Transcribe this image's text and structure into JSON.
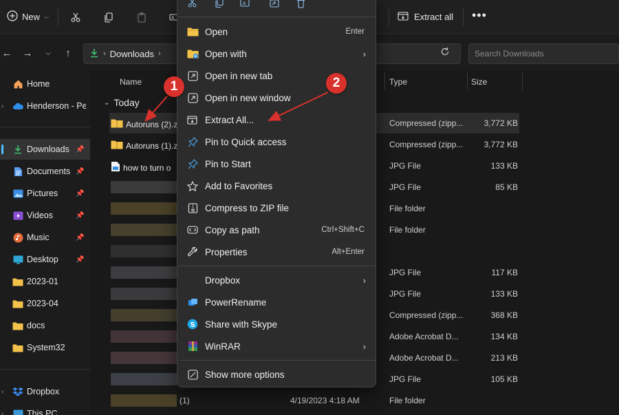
{
  "toolbar": {
    "new_label": "New",
    "extract_all_label": "Extract all",
    "more_label": "•••"
  },
  "address": {
    "path_segment": "Downloads",
    "search_placeholder": "Search Downloads"
  },
  "sidebar": {
    "items": [
      {
        "label": "Home",
        "icon": "home-icon",
        "pinned": false
      },
      {
        "label": "Henderson - Per",
        "icon": "onedrive-icon",
        "pinned": false
      },
      {
        "label": "Downloads",
        "icon": "download-icon",
        "pinned": true
      },
      {
        "label": "Documents",
        "icon": "document-icon",
        "pinned": true
      },
      {
        "label": "Pictures",
        "icon": "picture-icon",
        "pinned": true
      },
      {
        "label": "Videos",
        "icon": "video-icon",
        "pinned": true
      },
      {
        "label": "Music",
        "icon": "music-icon",
        "pinned": true
      },
      {
        "label": "Desktop",
        "icon": "desktop-icon",
        "pinned": true
      },
      {
        "label": "2023-01",
        "icon": "folder-icon",
        "pinned": false
      },
      {
        "label": "2023-04",
        "icon": "folder-icon",
        "pinned": false
      },
      {
        "label": "docs",
        "icon": "folder-icon",
        "pinned": false
      },
      {
        "label": "System32",
        "icon": "folder-icon",
        "pinned": false
      },
      {
        "label": "Dropbox",
        "icon": "dropbox-icon",
        "pinned": false
      },
      {
        "label": "This PC",
        "icon": "pc-icon",
        "pinned": false
      }
    ]
  },
  "list": {
    "columns": {
      "name": "Name",
      "type": "Type",
      "size": "Size"
    },
    "group": "Today",
    "rows": [
      {
        "name": "Autoruns (2).z",
        "date": "",
        "type": "Compressed (zipp...",
        "size": "3,772 KB"
      },
      {
        "name": "Autoruns (1).z",
        "date": "",
        "type": "Compressed (zipp...",
        "size": "3,772 KB"
      },
      {
        "name": "how to turn o",
        "date": "",
        "type": "JPG File",
        "size": "133 KB"
      },
      {
        "name": "",
        "date": "",
        "type": "JPG File",
        "size": "85 KB"
      },
      {
        "name": "",
        "date": "",
        "type": "File folder",
        "size": ""
      },
      {
        "name": "",
        "date": "",
        "type": "File folder",
        "size": ""
      },
      {
        "name": "",
        "date": "",
        "type": "",
        "size": ""
      },
      {
        "name": "",
        "date": "",
        "type": "JPG File",
        "size": "117 KB"
      },
      {
        "name": "",
        "date": "",
        "type": "JPG File",
        "size": "133 KB"
      },
      {
        "name": "",
        "date": "",
        "type": "Compressed (zipp...",
        "size": "368 KB"
      },
      {
        "name": "",
        "date": "",
        "type": "Adobe Acrobat D...",
        "size": "134 KB"
      },
      {
        "name": "",
        "date": "",
        "type": "Adobe Acrobat D...",
        "size": "213 KB"
      },
      {
        "name": "",
        "date": "",
        "type": "JPG File",
        "size": "105 KB"
      },
      {
        "name": "(1)",
        "date": "4/19/2023 4:18 AM",
        "type": "File folder",
        "size": ""
      }
    ]
  },
  "context_menu": {
    "items": [
      {
        "label": "Open",
        "shortcut": "Enter"
      },
      {
        "label": "Open with",
        "shortcut": ""
      },
      {
        "label": "Open in new tab",
        "shortcut": ""
      },
      {
        "label": "Open in new window",
        "shortcut": ""
      },
      {
        "label": "Extract All...",
        "shortcut": ""
      },
      {
        "label": "Pin to Quick access",
        "shortcut": ""
      },
      {
        "label": "Pin to Start",
        "shortcut": ""
      },
      {
        "label": "Add to Favorites",
        "shortcut": ""
      },
      {
        "label": "Compress to ZIP file",
        "shortcut": ""
      },
      {
        "label": "Copy as path",
        "shortcut": "Ctrl+Shift+C"
      },
      {
        "label": "Properties",
        "shortcut": "Alt+Enter"
      }
    ],
    "third_party": [
      {
        "label": "Dropbox"
      },
      {
        "label": "PowerRename"
      },
      {
        "label": "Share with Skype"
      },
      {
        "label": "WinRAR"
      }
    ],
    "more_options": "Show more options"
  },
  "callouts": {
    "one": "1",
    "two": "2"
  },
  "colors": {
    "accent": "#4cc2ff",
    "callout": "#d9312b",
    "folder": "#f3c24a"
  }
}
